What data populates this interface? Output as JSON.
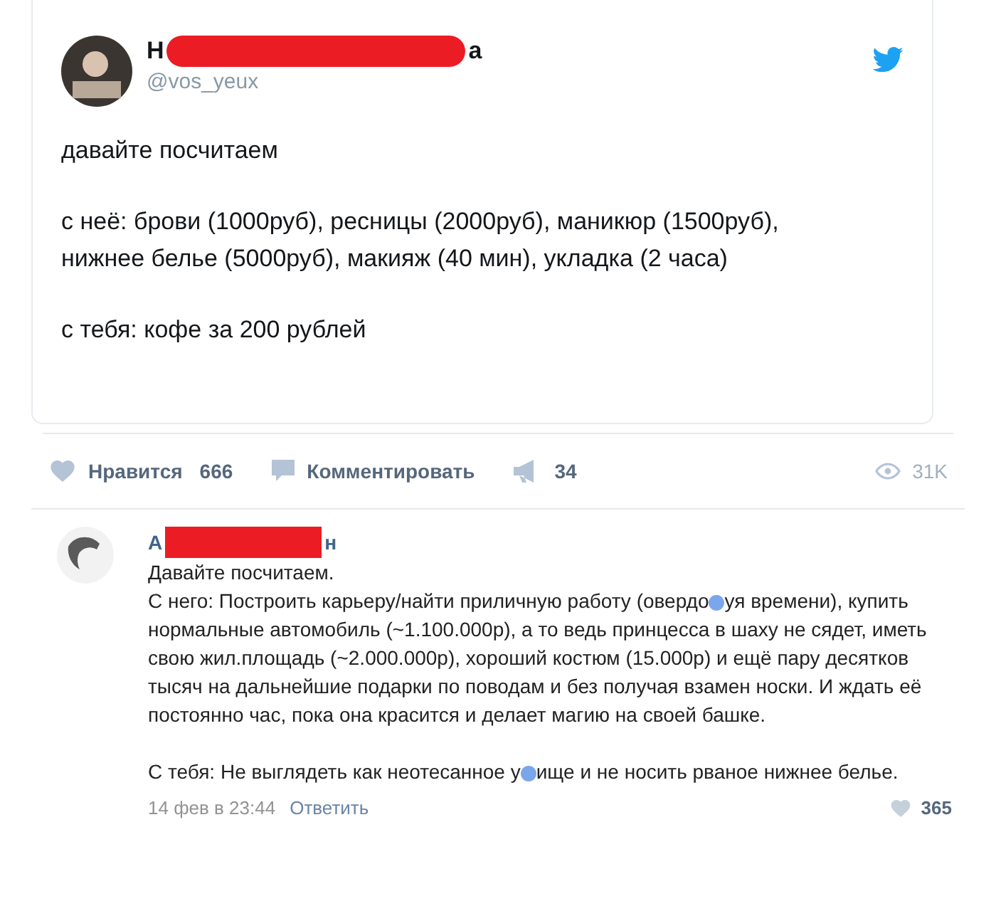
{
  "tweet": {
    "name_start": "Н",
    "name_end": "а",
    "handle": "@vos_yeux",
    "paragraphs": [
      "давайте посчитаем",
      "с неё: брови (1000руб), ресницы (2000руб), маникюр (1500руб), нижнее белье (5000руб), макияж (40 мин), укладка (2 часа)",
      "с тебя: кофе за 200 рублей"
    ]
  },
  "actions": {
    "like_label": "Нравится",
    "like_count": "666",
    "comment_label": "Комментировать",
    "share_count": "34",
    "views": "31K"
  },
  "comment": {
    "name_start": "А",
    "name_end": "н",
    "paragraphs": [
      [
        {
          "kind": "text",
          "text": "Давайте посчитаем."
        }
      ],
      [
        {
          "kind": "text",
          "text": "С него: Построить карьеру/найти приличную работу (овердо"
        },
        {
          "kind": "censor"
        },
        {
          "kind": "text",
          "text": "уя времени), купить нормальные автомобиль (~1.100.000р), а то ведь принцесса в шаху не сядет, иметь свою жил.площадь (~2.000.000р), хороший костюм (15.000р) и ещё пару десятков тысяч на дальнейшие подарки по поводам и без получая взамен носки. И ждать её постоянно час, пока она красится и делает магию на своей башке."
        }
      ],
      [
        {
          "kind": "text",
          "text": "С тебя: Не выглядеть как неотесанное у"
        },
        {
          "kind": "censor"
        },
        {
          "kind": "text",
          "text": "ище и не носить рваное нижнее белье."
        }
      ]
    ],
    "date": "14 фев в 23:44",
    "reply": "Ответить",
    "likes": "365"
  }
}
